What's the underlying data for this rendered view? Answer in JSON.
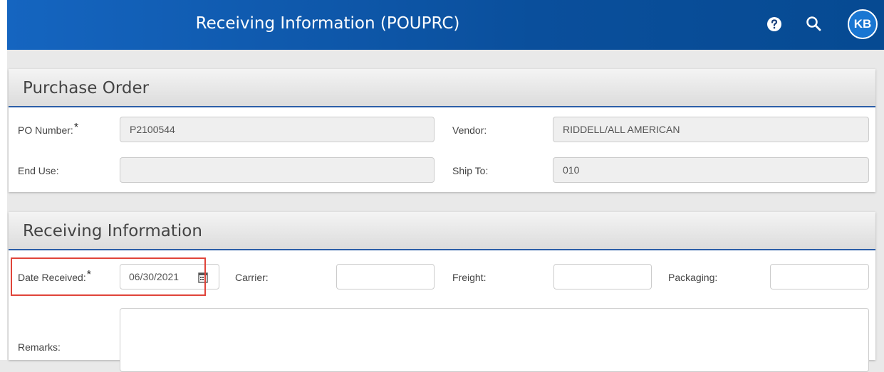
{
  "header": {
    "title": "Receiving Information (POUPRC)",
    "avatar_initials": "KB",
    "help_icon": "question-circle-icon",
    "search_icon": "search-icon"
  },
  "purchase_order": {
    "title": "Purchase Order",
    "po_number_label": "PO Number:",
    "po_number_value": "P2100544",
    "vendor_label": "Vendor:",
    "vendor_value": "RIDDELL/ALL AMERICAN",
    "end_use_label": "End Use:",
    "end_use_value": "",
    "ship_to_label": "Ship To:",
    "ship_to_value": "010"
  },
  "receiving": {
    "title": "Receiving Information",
    "date_received_label": "Date Received:",
    "date_received_value": "06/30/2021",
    "calendar_icon": "calendar-icon",
    "carrier_label": "Carrier:",
    "carrier_value": "",
    "freight_label": "Freight:",
    "freight_value": "",
    "packaging_label": "Packaging:",
    "packaging_value": "",
    "remarks_label": "Remarks:",
    "remarks_value": ""
  },
  "required_marker": "*",
  "colors": {
    "header_blue": "#1565c0",
    "section_underline": "#2b5ea7",
    "highlight_red": "#e0443a"
  }
}
